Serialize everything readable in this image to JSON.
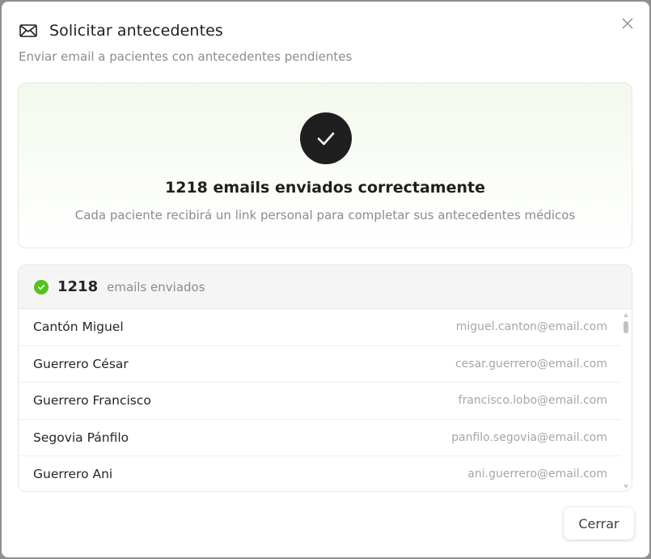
{
  "dialog": {
    "title": "Solicitar antecedentes",
    "subtitle": "Enviar email a pacientes con antecedentes pendientes",
    "icon": "mail-icon",
    "close_icon": "close-icon"
  },
  "success": {
    "icon": "check-icon",
    "title": "1218 emails enviados correctamente",
    "description": "Cada paciente recibirá un link personal para completar sus antecedentes médicos",
    "accent_color": "#1f1f1f"
  },
  "list": {
    "status_icon": "check-circle-icon",
    "status_color": "#52c41a",
    "count": "1218",
    "count_label": "emails enviados",
    "rows": [
      {
        "name": "Cantón Miguel",
        "email": "miguel.canton@email.com"
      },
      {
        "name": "Guerrero César",
        "email": "cesar.guerrero@email.com"
      },
      {
        "name": "Guerrero Francisco",
        "email": "francisco.lobo@email.com"
      },
      {
        "name": "Segovia Pánfilo",
        "email": "panfilo.segovia@email.com"
      },
      {
        "name": "Guerrero Ani",
        "email": "ani.guerrero@email.com"
      }
    ]
  },
  "footer": {
    "close_label": "Cerrar"
  }
}
